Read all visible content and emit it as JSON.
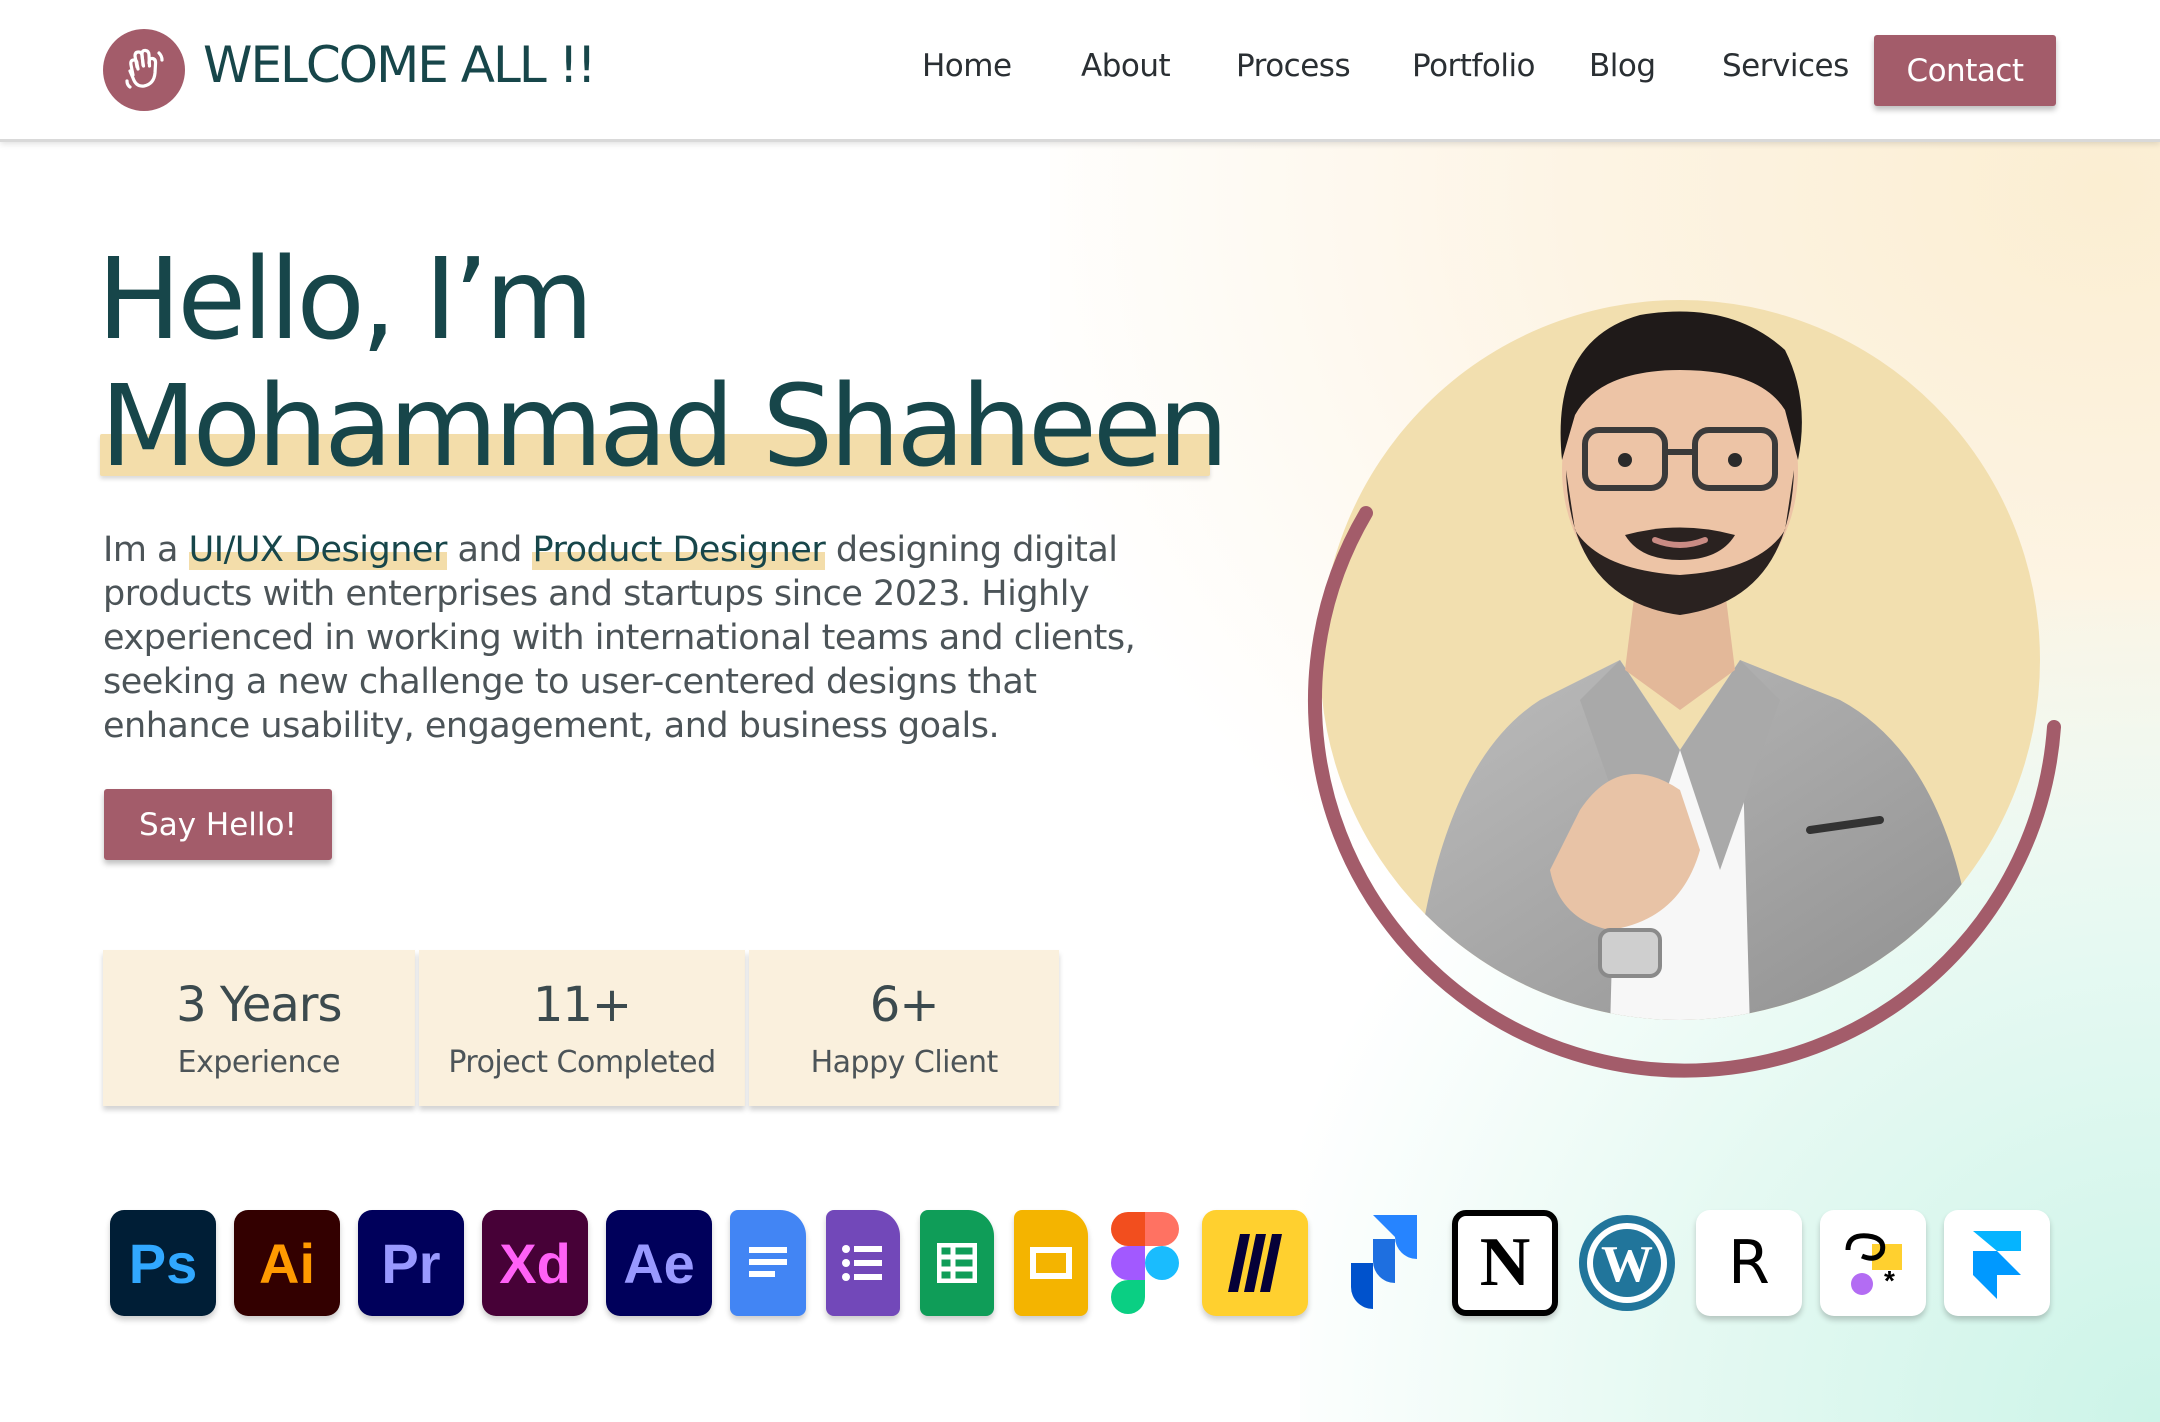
{
  "header": {
    "brand": "WELCOME ALL !!",
    "logo_icon": "waving-hand-icon",
    "nav": [
      "Home",
      "About",
      "Process",
      "Portfolio",
      "Blog",
      "Services"
    ],
    "contact_label": "Contact"
  },
  "hero": {
    "greeting": "Hello,  I’m",
    "name": "Mohammad Shaheen",
    "bio": {
      "p1": "Im a ",
      "role1": "UI/UX Designer",
      "p2": " and ",
      "role2": "Product Designer",
      "p3": " designing digital products with enterprises and startups since 2023. Highly experienced in working with international teams and clients, seeking a new challenge to  user-centered designs that enhance usability, engagement, and business goals."
    },
    "cta_label": "Say Hello!"
  },
  "stats": [
    {
      "value": "3  Years",
      "label": "Experience"
    },
    {
      "value": "11+",
      "label": "Project Completed"
    },
    {
      "value": "6+",
      "label": "Happy Client"
    }
  ],
  "tools": [
    {
      "icon": "photoshop-icon",
      "text": "Ps",
      "bg": "#001e36",
      "fg": "#31a8ff"
    },
    {
      "icon": "illustrator-icon",
      "text": "Ai",
      "bg": "#330000",
      "fg": "#ff9a00"
    },
    {
      "icon": "premiere-icon",
      "text": "Pr",
      "bg": "#00005b",
      "fg": "#9999ff"
    },
    {
      "icon": "xd-icon",
      "text": "Xd",
      "bg": "#470137",
      "fg": "#ff61f6"
    },
    {
      "icon": "after-effects-icon",
      "text": "Ae",
      "bg": "#00005b",
      "fg": "#9999ff"
    },
    {
      "icon": "google-docs-icon",
      "text": "",
      "bg": "#4285f4",
      "fg": "#ffffff"
    },
    {
      "icon": "google-forms-icon",
      "text": "",
      "bg": "#7248b9",
      "fg": "#ffffff"
    },
    {
      "icon": "google-sheets-icon",
      "text": "",
      "bg": "#0f9d58",
      "fg": "#ffffff"
    },
    {
      "icon": "google-slides-icon",
      "text": "",
      "bg": "#f4b400",
      "fg": "#ffffff"
    },
    {
      "icon": "figma-icon",
      "text": "",
      "bg": "#ffffff",
      "fg": "#000000"
    },
    {
      "icon": "miro-icon",
      "text": "",
      "bg": "#ffd02f",
      "fg": "#050038"
    },
    {
      "icon": "jira-icon",
      "text": "",
      "bg": "#ffffff",
      "fg": "#2684ff"
    },
    {
      "icon": "notion-icon",
      "text": "N",
      "bg": "#ffffff",
      "fg": "#000000"
    },
    {
      "icon": "wordpress-icon",
      "text": "",
      "bg": "#ffffff",
      "fg": "#21759b"
    },
    {
      "icon": "relume-icon",
      "text": "R",
      "bg": "#ffffff",
      "fg": "#000000"
    },
    {
      "icon": "galileo-ai-icon",
      "text": "",
      "bg": "#ffffff",
      "fg": "#000000"
    },
    {
      "icon": "framer-icon",
      "text": "",
      "bg": "#ffffff",
      "fg": "#0099ff"
    }
  ],
  "colors": {
    "accent": "#a35c6a",
    "heading": "#17464a",
    "highlight": "#f3ddaa",
    "card": "#faf0dd"
  }
}
